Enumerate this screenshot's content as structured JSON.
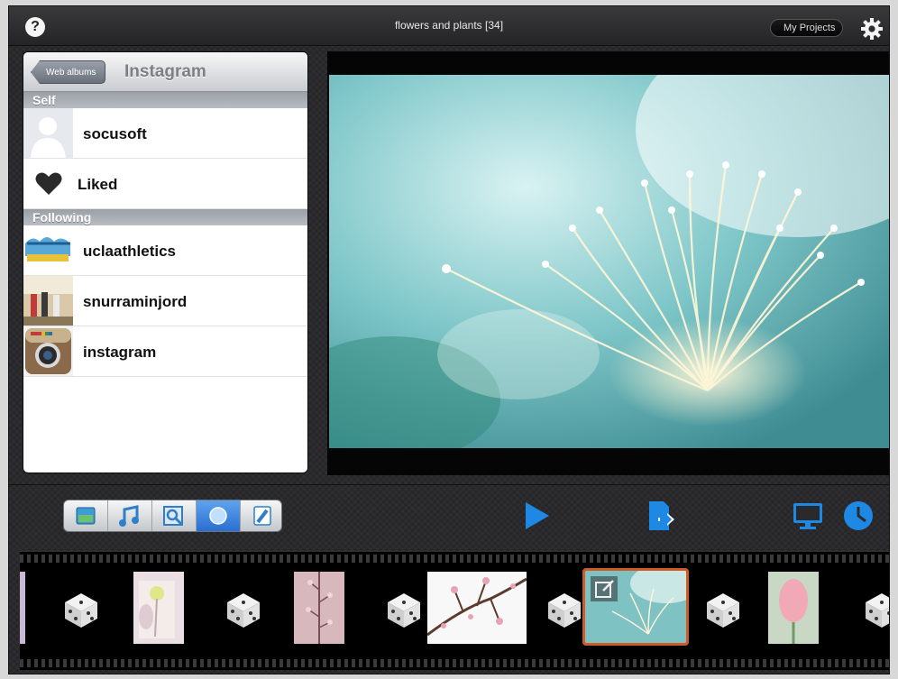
{
  "header": {
    "title": "flowers and plants  [34]",
    "help_label": "?",
    "my_projects_label": "My Projects"
  },
  "album_panel": {
    "back_label": "Web albums",
    "title": "Instagram",
    "sections": [
      {
        "header": "Self",
        "items": [
          {
            "label": "socusoft",
            "icon": "person-silhouette-icon"
          },
          {
            "label": "Liked",
            "icon": "heart-icon"
          }
        ]
      },
      {
        "header": "Following",
        "items": [
          {
            "label": "uclaathletics",
            "icon": "ucla-avatar"
          },
          {
            "label": "snurraminjord",
            "icon": "snurraminjord-avatar"
          },
          {
            "label": "instagram",
            "icon": "instagram-camera-avatar"
          }
        ]
      }
    ]
  },
  "toolbar": {
    "segments": [
      "photo-icon",
      "music-icon",
      "zoom-icon",
      "circle-icon",
      "pen-icon"
    ],
    "active_segment": 3,
    "play": "play-icon",
    "export": "export-icon",
    "display": "monitor-icon",
    "timer": "clock-icon"
  },
  "colors": {
    "accent": "#1e88e5",
    "selected_clip_border": "#d05a28"
  },
  "filmstrip": {
    "clips": [
      "clip-partial",
      "dice-transition",
      "clip-flower-yellow",
      "dice-transition",
      "clip-pink-blossom-stem",
      "dice-transition",
      "clip-cherry-blossom-branch",
      "dice-transition",
      "clip-white-flower-selected",
      "dice-transition",
      "clip-pink-tulip",
      "dice-transition"
    ],
    "selected_index": 8
  }
}
